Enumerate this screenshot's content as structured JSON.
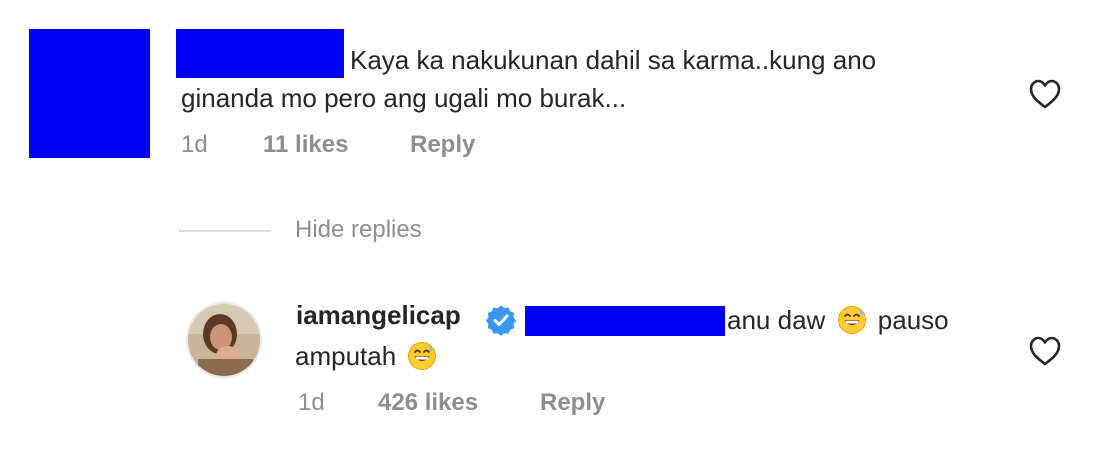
{
  "comment": {
    "text_line1": "Kaya ka nakukunan dahil sa karma..kung ano",
    "text_line2": "ginanda mo pero ang ugali mo burak...",
    "time": "1d",
    "likes": "11 likes",
    "reply_label": "Reply"
  },
  "thread": {
    "hide_replies_label": "Hide replies"
  },
  "reply": {
    "username": "iamangelicap",
    "text_part1": "anu daw",
    "text_part2": "pauso",
    "text_line2": "amputah",
    "time": "1d",
    "likes": "426 likes",
    "reply_label": "Reply"
  },
  "icons": {
    "like": "heart-outline-icon",
    "verified": "verified-badge-icon",
    "emoji": "grinning-sweat-emoji"
  },
  "colors": {
    "redaction": "#0000ff",
    "text": "#262626",
    "muted": "#8e8e8e",
    "verified": "#3897f0"
  }
}
